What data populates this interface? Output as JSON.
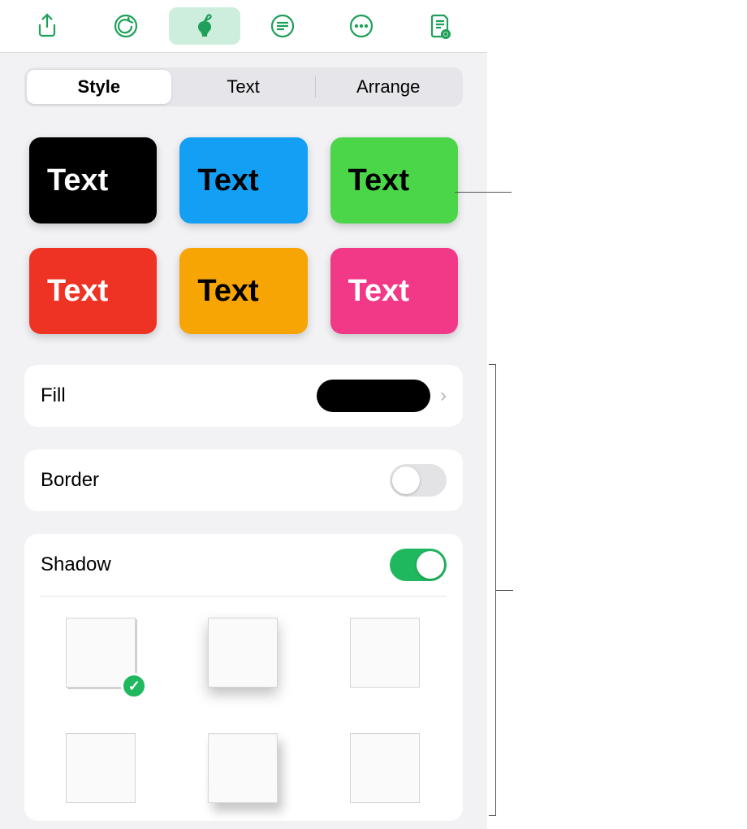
{
  "toolbar": {
    "share": "share",
    "undo": "undo",
    "format": "format-brush",
    "document": "document-settings",
    "more": "more",
    "reader": "reader-view"
  },
  "tabs": {
    "style": "Style",
    "text": "Text",
    "arrange": "Arrange"
  },
  "presets": {
    "label": "Text"
  },
  "rows": {
    "fill": "Fill",
    "border": "Border",
    "shadow": "Shadow"
  },
  "fill": {
    "color": "#000000"
  },
  "toggles": {
    "border": false,
    "shadow": true
  },
  "shadow": {
    "selectedIndex": 0
  }
}
